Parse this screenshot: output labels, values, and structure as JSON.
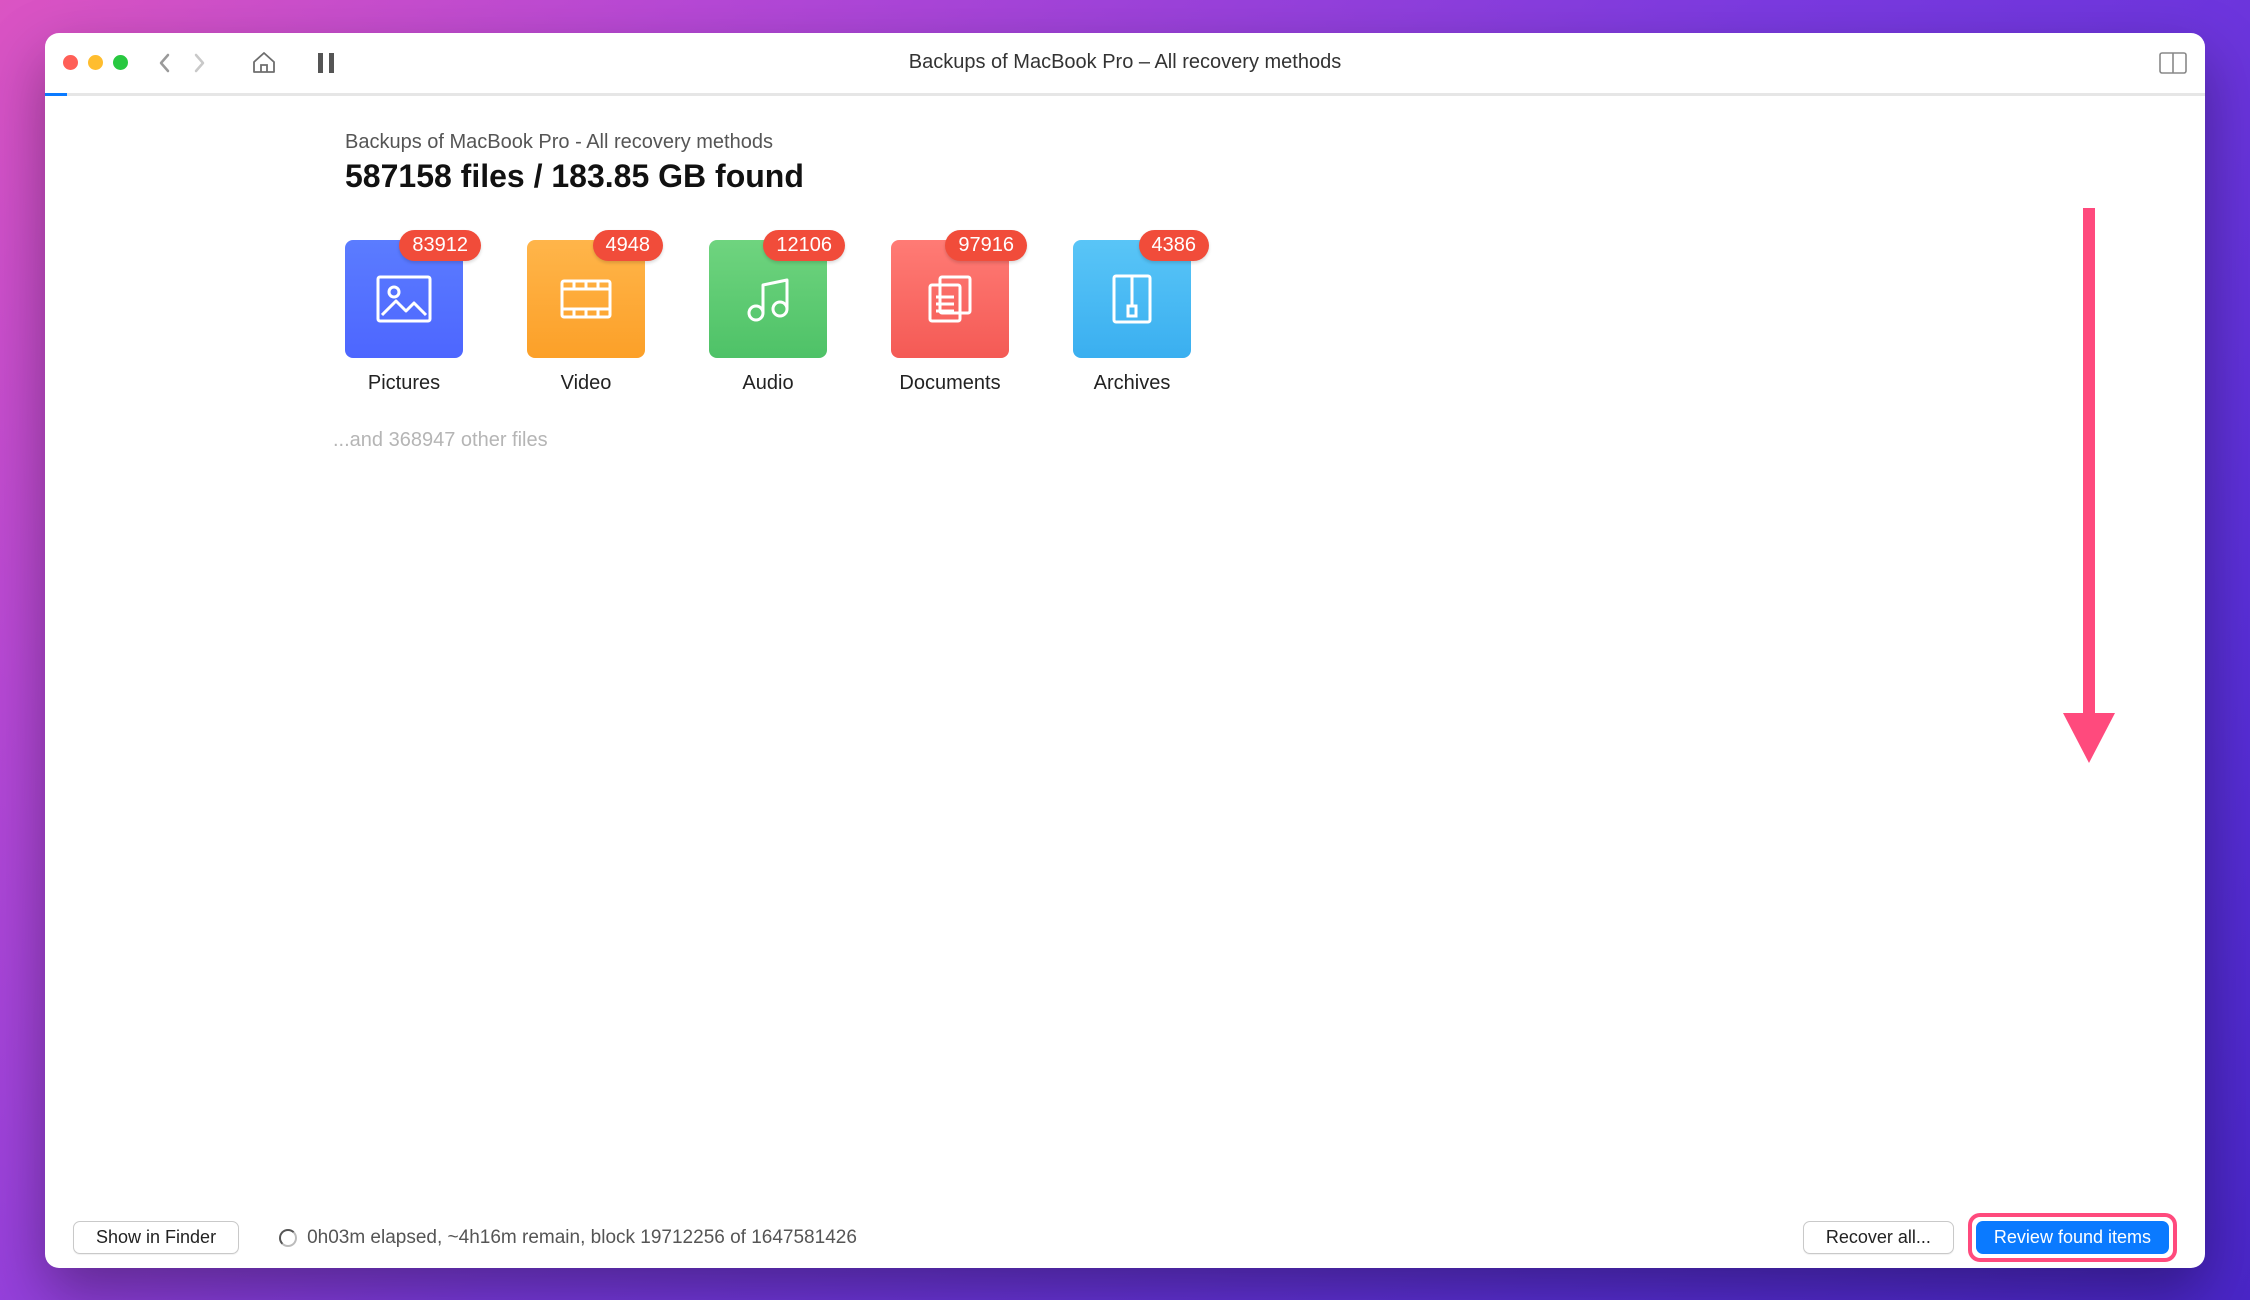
{
  "toolbar": {
    "window_title": "Backups of MacBook Pro – All recovery methods"
  },
  "main": {
    "subtitle": "Backups of MacBook Pro - All recovery methods",
    "headline": "587158 files / 183.85 GB found",
    "categories": [
      {
        "id": "pictures",
        "label": "Pictures",
        "count": "83912"
      },
      {
        "id": "video",
        "label": "Video",
        "count": "4948"
      },
      {
        "id": "audio",
        "label": "Audio",
        "count": "12106"
      },
      {
        "id": "documents",
        "label": "Documents",
        "count": "97916"
      },
      {
        "id": "archives",
        "label": "Archives",
        "count": "4386"
      }
    ],
    "other_files_line": "...and 368947 other files"
  },
  "footer": {
    "show_in_finder": "Show in Finder",
    "status": "0h03m elapsed, ~4h16m remain, block 19712256 of 1647581426",
    "recover_all": "Recover all...",
    "review_found": "Review found items"
  }
}
